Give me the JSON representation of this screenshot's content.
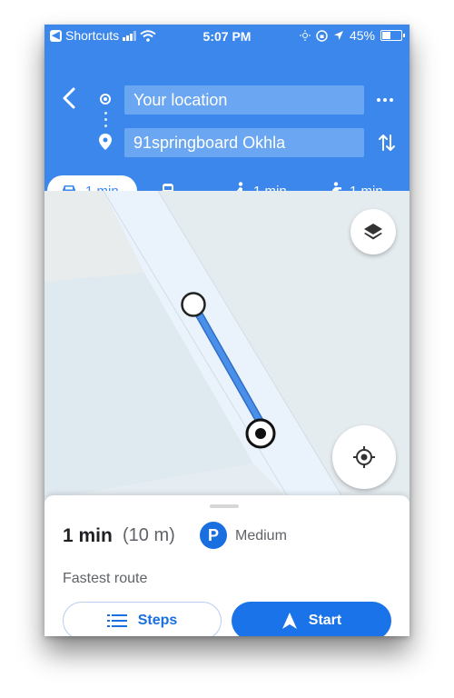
{
  "status_bar": {
    "back_app": "Shortcuts",
    "time": "5:07 PM",
    "battery": "45%"
  },
  "search": {
    "origin": "Your location",
    "destination": "91springboard Okhla"
  },
  "travel_modes": [
    {
      "icon": "car-icon",
      "label": "1 min"
    },
    {
      "icon": "transit-icon",
      "label": "—"
    },
    {
      "icon": "walk-icon",
      "label": "1 min"
    },
    {
      "icon": "ride-icon",
      "label": "1 min"
    }
  ],
  "route": {
    "duration": "1 min",
    "distance": "(10 m)",
    "parking_badge": "P",
    "parking": "Medium",
    "description": "Fastest route"
  },
  "actions": {
    "steps": "Steps",
    "start": "Start"
  },
  "colors": {
    "header_blue": "#3b87ec",
    "accent_blue": "#1a73e8",
    "route_blue": "#4a8fe8"
  }
}
